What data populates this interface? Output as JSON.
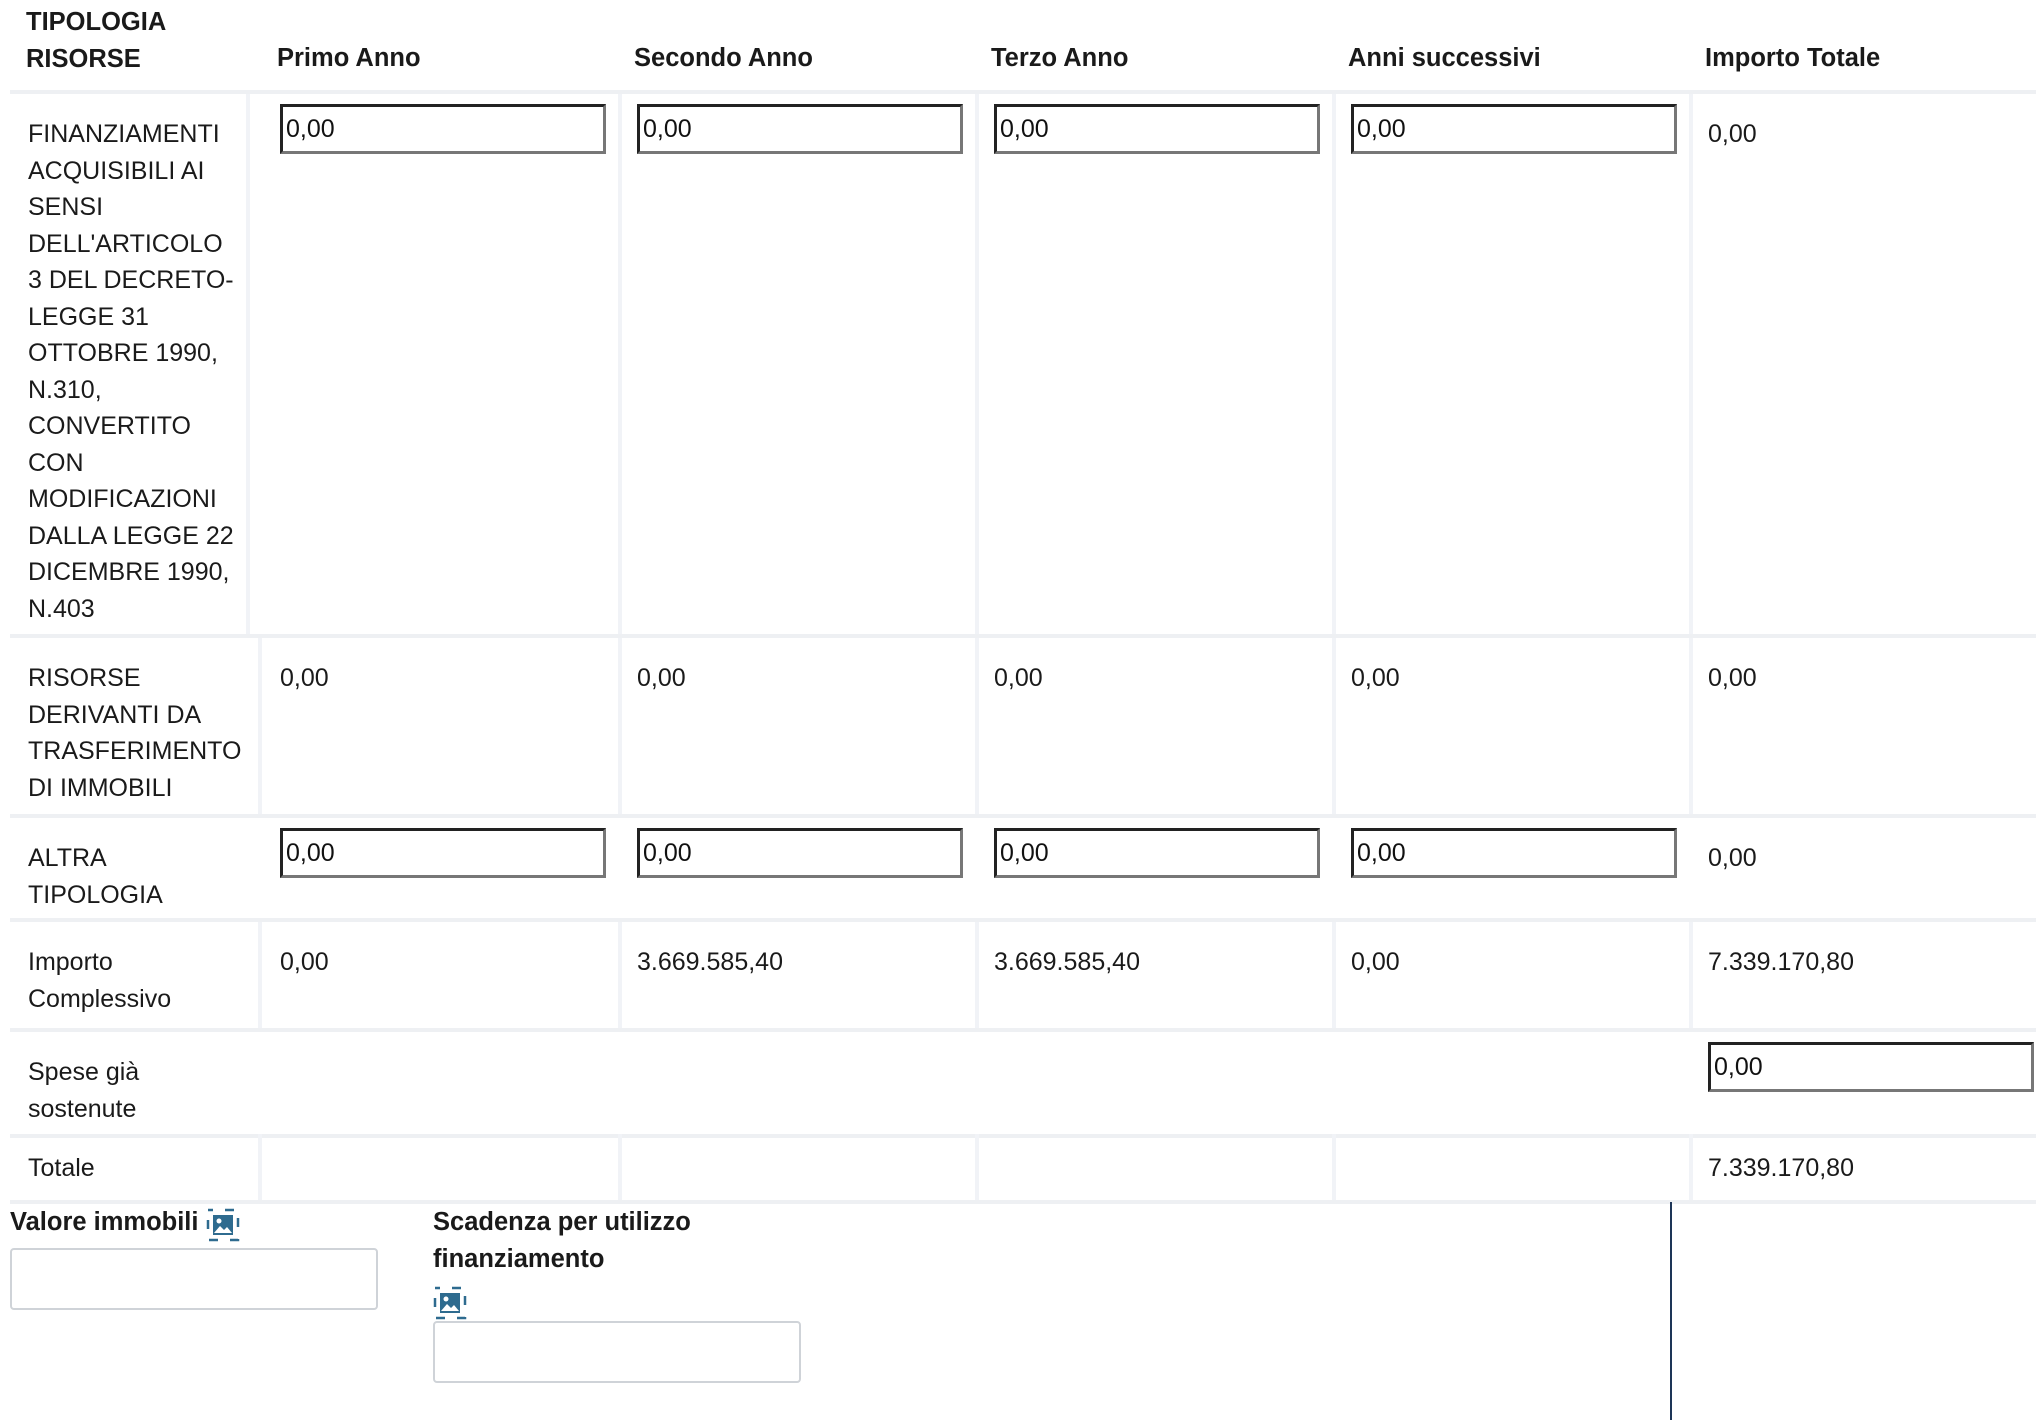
{
  "table": {
    "headers": [
      "TIPOLOGIA RISORSE",
      "Primo Anno",
      "Secondo Anno",
      "Terzo Anno",
      "Anni successivi",
      "Importo Totale"
    ],
    "rows": [
      {
        "label": "FINANZIAMENTI ACQUISIBILI AI SENSI DELL'ARTICOLO 3 DEL DECRETO-LEGGE 31 OTTOBRE 1990, N.310, CONVERTITO CON MODIFICAZIONI DALLA LEGGE 22 DICEMBRE 1990, N.403",
        "values": [
          "0,00",
          "0,00",
          "0,00",
          "0,00"
        ],
        "total": "0,00"
      },
      {
        "label": "RISORSE DERIVANTI DA TRASFERIMENTO DI IMMOBILI",
        "values": [
          "0,00",
          "0,00",
          "0,00",
          "0,00"
        ],
        "total": "0,00"
      },
      {
        "label": "ALTRA TIPOLOGIA",
        "values": [
          "0,00",
          "0,00",
          "0,00",
          "0,00"
        ],
        "total": "0,00"
      },
      {
        "label": "Importo Complessivo",
        "values": [
          "0,00",
          "3.669.585,40",
          "3.669.585,40",
          "0,00"
        ],
        "total": "7.339.170,80"
      },
      {
        "label": "Spese già sostenute",
        "total": "0,00"
      },
      {
        "label": "Totale",
        "total": "7.339.170,80"
      }
    ]
  },
  "fields": {
    "valore_immobili_label": "Valore immobili",
    "valore_immobili_value": "",
    "scadenza_label": "Scadenza per utilizzo finanziamento",
    "scadenza_value": ""
  },
  "icons": {
    "info_icon": "image-icon"
  },
  "colors": {
    "icon_blue": "#2e6b8f",
    "divider": "#1d3557"
  }
}
